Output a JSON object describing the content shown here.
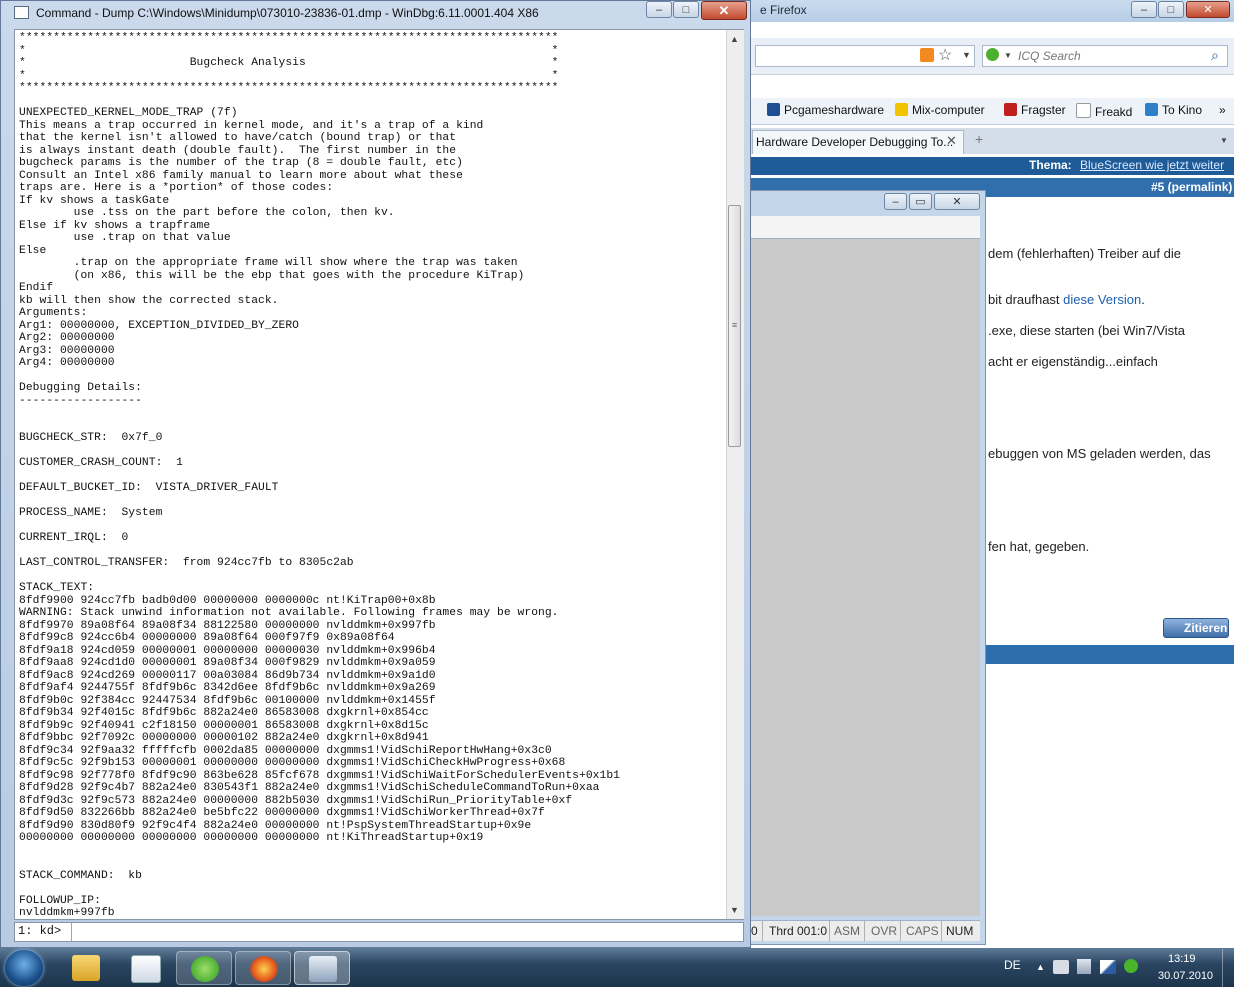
{
  "firefox": {
    "title": "e Firefox",
    "search_placeholder": "ICQ Search",
    "bookmarks": [
      {
        "label": "Pcgameshardware",
        "icon": "pcgh-icon",
        "color": "#1d4f91"
      },
      {
        "label": "Mix-computer",
        "icon": "m-icon",
        "color": "#f3c300"
      },
      {
        "label": "Fragster",
        "icon": "fragster-icon",
        "color": "#c0201c"
      },
      {
        "label": "Freakd",
        "icon": "page-icon",
        "color": "#ffffff"
      },
      {
        "label": "To Kino",
        "icon": "kino-icon",
        "color": "#2e7fc9"
      }
    ],
    "bookmarks_more": "»",
    "tab_label": "Hardware Developer Debugging To...",
    "forum_header_prefix": "Thema:",
    "forum_header_link": "BlueScreen wie jetzt weiter",
    "forum_post_link": "#5 (permalink)",
    "paragraphs": [
      {
        "pre": "dem (fehlerhaften) Treiber auf die",
        "link": "",
        "post": ""
      },
      {
        "pre": "bit draufhast ",
        "link": "diese Version",
        "post": "."
      },
      {
        "pre": ".exe, diese starten (bei Win7/Vista",
        "link": "",
        "post": ""
      },
      {
        "pre": "acht er eigenständig...einfach",
        "link": "",
        "post": ""
      },
      {
        "pre": "ebuggen von MS geladen werden, das",
        "link": "",
        "post": ""
      },
      {
        "pre": "fen hat, gegeben.",
        "link": "",
        "post": ""
      }
    ],
    "quote_button": "Zitieren"
  },
  "windbg": {
    "status": [
      "0",
      "Thrd 001:0",
      "ASM",
      "OVR",
      "CAPS",
      "NUM"
    ]
  },
  "command_window": {
    "title": "Command - Dump C:\\Windows\\Minidump\\073010-23836-01.dmp - WinDbg:6.11.0001.404 X86",
    "output_lines": [
      "*******************************************************************************",
      "*                                                                             *",
      "*                        Bugcheck Analysis                                    *",
      "*                                                                             *",
      "*******************************************************************************",
      "",
      "UNEXPECTED_KERNEL_MODE_TRAP (7f)",
      "This means a trap occurred in kernel mode, and it's a trap of a kind",
      "that the kernel isn't allowed to have/catch (bound trap) or that",
      "is always instant death (double fault).  The first number in the",
      "bugcheck params is the number of the trap (8 = double fault, etc)",
      "Consult an Intel x86 family manual to learn more about what these",
      "traps are. Here is a *portion* of those codes:",
      "If kv shows a taskGate",
      "        use .tss on the part before the colon, then kv.",
      "Else if kv shows a trapframe",
      "        use .trap on that value",
      "Else",
      "        .trap on the appropriate frame will show where the trap was taken",
      "        (on x86, this will be the ebp that goes with the procedure KiTrap)",
      "Endif",
      "kb will then show the corrected stack.",
      "Arguments:",
      "Arg1: 00000000, EXCEPTION_DIVIDED_BY_ZERO",
      "Arg2: 00000000",
      "Arg3: 00000000",
      "Arg4: 00000000",
      "",
      "Debugging Details:",
      "------------------",
      "",
      "",
      "BUGCHECK_STR:  0x7f_0",
      "",
      "CUSTOMER_CRASH_COUNT:  1",
      "",
      "DEFAULT_BUCKET_ID:  VISTA_DRIVER_FAULT",
      "",
      "PROCESS_NAME:  System",
      "",
      "CURRENT_IRQL:  0",
      "",
      "LAST_CONTROL_TRANSFER:  from 924cc7fb to 8305c2ab",
      "",
      "STACK_TEXT:",
      "8fdf9900 924cc7fb badb0d00 00000000 0000000c nt!KiTrap00+0x8b",
      "WARNING: Stack unwind information not available. Following frames may be wrong.",
      "8fdf9970 89a08f64 89a08f34 88122580 00000000 nvlddmkm+0x997fb",
      "8fdf99c8 924cc6b4 00000000 89a08f64 000f97f9 0x89a08f64",
      "8fdf9a18 924cd059 00000001 00000000 00000030 nvlddmkm+0x996b4",
      "8fdf9aa8 924cd1d0 00000001 89a08f34 000f9829 nvlddmkm+0x9a059",
      "8fdf9ac8 924cd269 00000117 00a03084 86d9b734 nvlddmkm+0x9a1d0",
      "8fdf9af4 9244755f 8fdf9b6c 8342d6ee 8fdf9b6c nvlddmkm+0x9a269",
      "8fdf9b0c 92f384cc 92447534 8fdf9b6c 00100000 nvlddmkm+0x1455f",
      "8fdf9b34 92f4015c 8fdf9b6c 882a24e0 86583008 dxgkrnl+0x854cc",
      "8fdf9b9c 92f40941 c2f18150 00000001 86583008 dxgkrnl+0x8d15c",
      "8fdf9bbc 92f7092c 00000000 00000102 882a24e0 dxgkrnl+0x8d941",
      "8fdf9c34 92f9aa32 fffffcfb 0002da85 00000000 dxgmms1!VidSchiReportHwHang+0x3c0",
      "8fdf9c5c 92f9b153 00000001 00000000 00000000 dxgmms1!VidSchiCheckHwProgress+0x68",
      "8fdf9c98 92f778f0 8fdf9c90 863be628 85fcf678 dxgmms1!VidSchiWaitForSchedulerEvents+0x1b1",
      "8fdf9d28 92f9c4b7 882a24e0 830543f1 882a24e0 dxgmms1!VidSchiScheduleCommandToRun+0xaa",
      "8fdf9d3c 92f9c573 882a24e0 00000000 882b5030 dxgmms1!VidSchiRun_PriorityTable+0xf",
      "8fdf9d50 832266bb 882a24e0 be5bfc22 00000000 dxgmms1!VidSchiWorkerThread+0x7f",
      "8fdf9d90 830d80f9 92f9c4f4 882a24e0 00000000 nt!PspSystemThreadStartup+0x9e",
      "00000000 00000000 00000000 00000000 00000000 nt!KiThreadStartup+0x19",
      "",
      "",
      "STACK_COMMAND:  kb",
      "",
      "FOLLOWUP_IP:",
      "nvlddmkm+997fb"
    ],
    "prompt": "1: kd>",
    "input_value": ""
  },
  "taskbar": {
    "language": "DE",
    "time": "13:19",
    "date": "30.07.2010"
  }
}
